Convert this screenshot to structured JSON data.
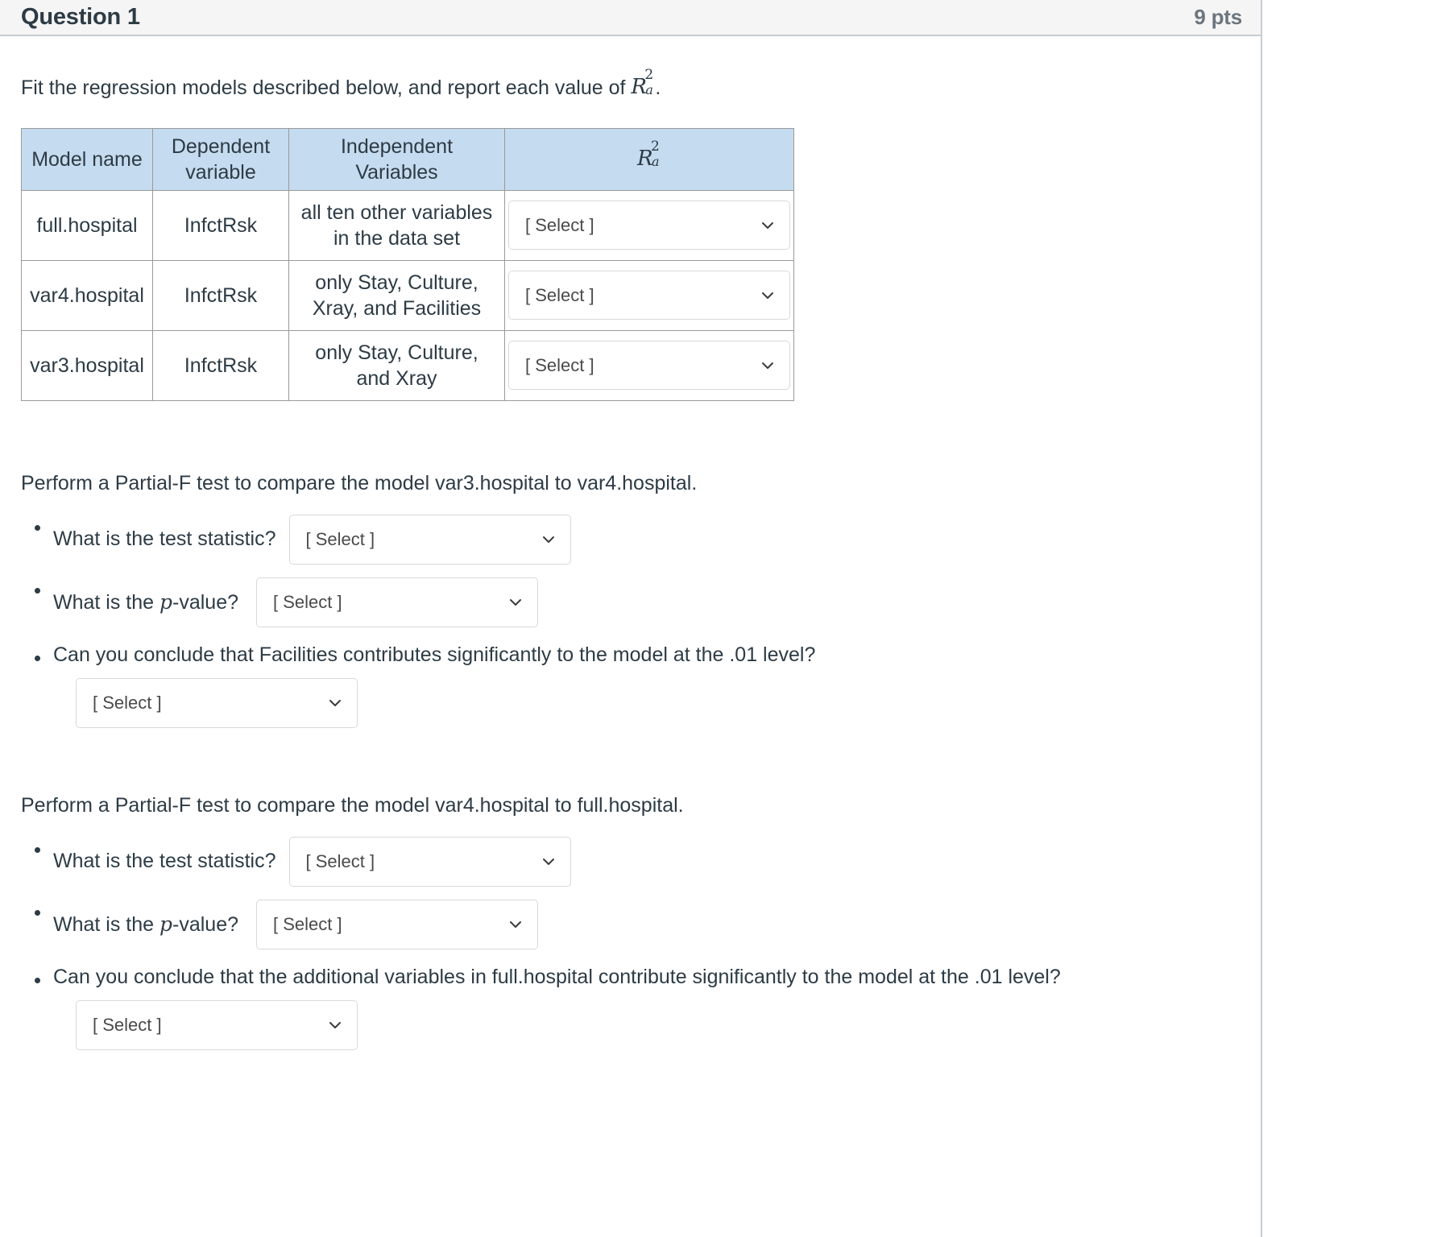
{
  "header": {
    "title": "Question 1",
    "points": "9 pts"
  },
  "intro": {
    "text_before": "Fit the regression models described below, and report each value of ",
    "math": {
      "base": "R",
      "sup": "2",
      "sub": "a"
    },
    "text_after": "."
  },
  "models_table": {
    "columns": [
      "Model name",
      "Dependent variable",
      "Independent Variables",
      "R2a"
    ],
    "column_headers": {
      "model_name": "Model name",
      "dependent_line1": "Dependent",
      "dependent_line2": "variable",
      "independent_line1": "Independent",
      "independent_line2": "Variables",
      "r2_base": "R",
      "r2_sup": "2",
      "r2_sub": "a"
    },
    "rows": [
      {
        "model_name": "full.hospital",
        "dependent": "InfctRsk",
        "independent_line1": "all ten other variables",
        "independent_line2": "in the data set",
        "select_value": "[ Select ]"
      },
      {
        "model_name": "var4.hospital",
        "dependent": "InfctRsk",
        "independent_line1": "only Stay, Culture,",
        "independent_line2": "Xray, and Facilities",
        "select_value": "[ Select ]"
      },
      {
        "model_name": "var3.hospital",
        "dependent": "InfctRsk",
        "independent_line1": "only Stay, Culture,",
        "independent_line2": "and Xray",
        "select_value": "[ Select ]"
      }
    ]
  },
  "section1": {
    "prompt": "Perform a Partial-F test to compare the model var3.hospital to var4.hospital.",
    "items": [
      {
        "label": "What is the test statistic?",
        "select_value": "[ Select ]"
      },
      {
        "label_pre": "What is the ",
        "label_math": "p",
        "label_post": "-value?",
        "select_value": "[ Select ]"
      },
      {
        "label": "Can you conclude that Facilities contributes significantly to the model at the .01 level?",
        "select_value": "[ Select ]"
      }
    ]
  },
  "section2": {
    "prompt": "Perform a Partial-F test to compare the model var4.hospital to full.hospital.",
    "items": [
      {
        "label": "What is the test statistic?",
        "select_value": "[ Select ]"
      },
      {
        "label_pre": "What is the ",
        "label_math": "p",
        "label_post": "-value?",
        "select_value": "[ Select ]"
      },
      {
        "label": "Can you conclude that the additional variables in full.hospital contribute significantly to the model at the .01 level?",
        "select_value": "[ Select ]"
      }
    ]
  },
  "icons": {
    "chevron_down": "chevron-down-icon"
  },
  "colors": {
    "table_header_bg": "#c5dbef",
    "header_bar_bg": "#f5f5f5",
    "border": "#c7cdd1",
    "text": "#2d3b45"
  }
}
